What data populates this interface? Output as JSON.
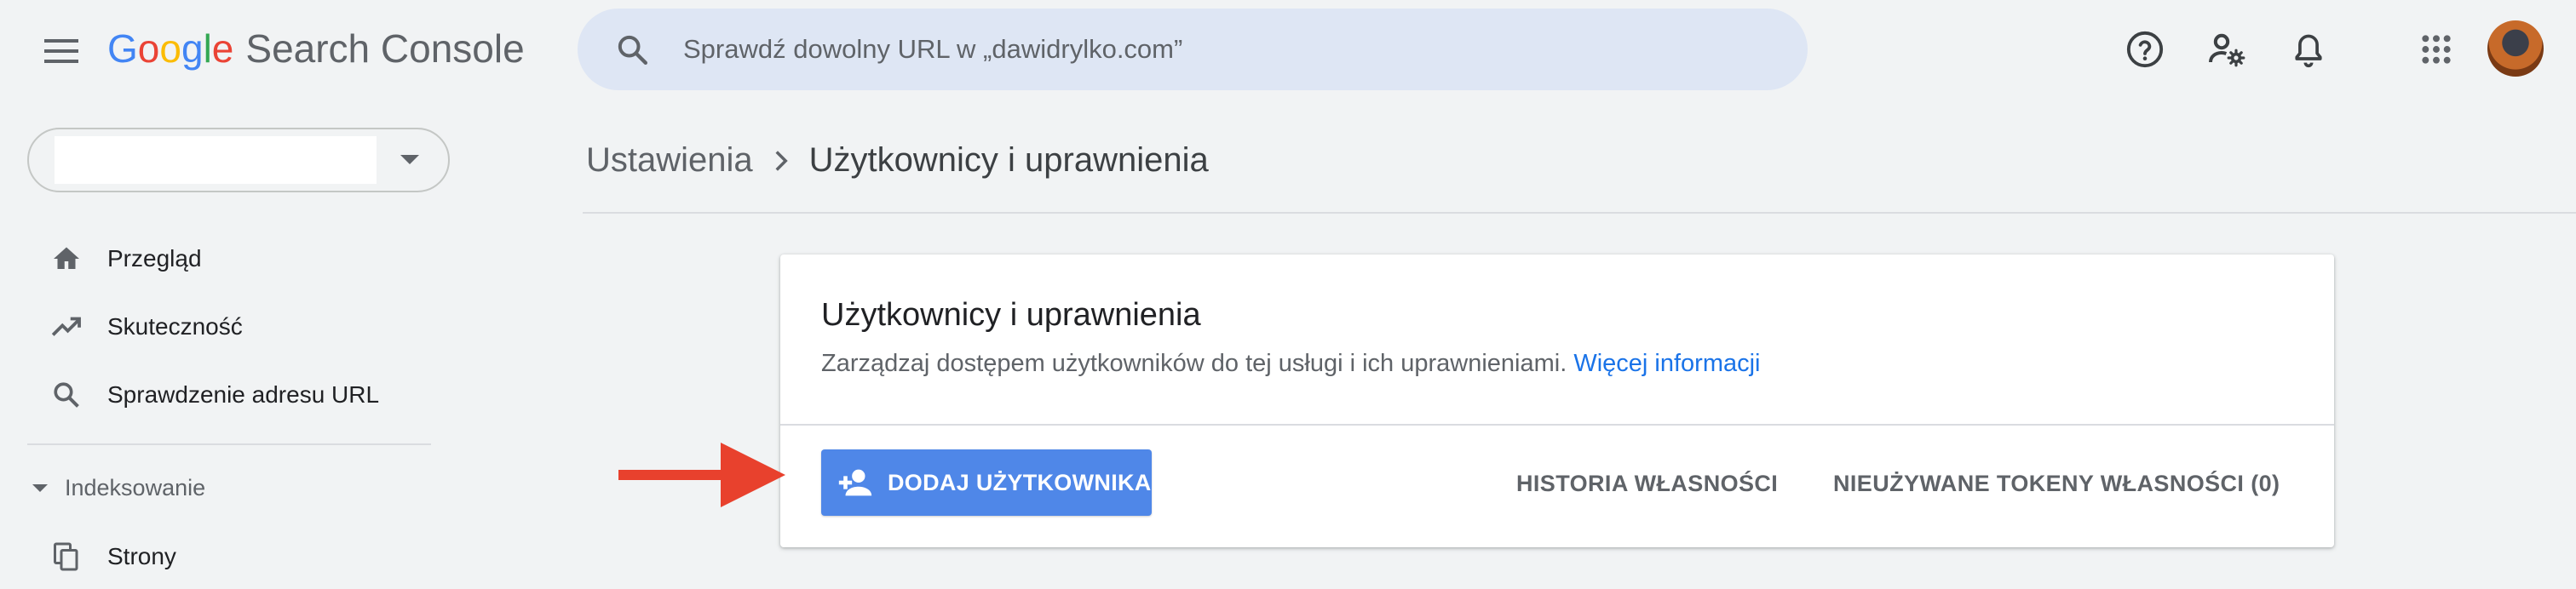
{
  "app": {
    "logo_letters": [
      "G",
      "o",
      "o",
      "g",
      "l",
      "e"
    ],
    "product_name": "Search Console"
  },
  "search": {
    "placeholder": "Sprawdź dowolny URL w „dawidrylko.com”"
  },
  "header_icons": [
    "help-icon",
    "manage-account-icon",
    "notifications-icon",
    "apps-grid-icon",
    "avatar"
  ],
  "property_selector": {
    "value": ""
  },
  "sidebar": {
    "items": [
      {
        "label": "Przegląd",
        "icon": "home-icon"
      },
      {
        "label": "Skuteczność",
        "icon": "trending-up-icon"
      },
      {
        "label": "Sprawdzenie adresu URL",
        "icon": "search-icon"
      }
    ],
    "section": {
      "label": "Indeksowanie",
      "items": [
        {
          "label": "Strony",
          "icon": "pages-icon"
        }
      ]
    }
  },
  "breadcrumb": {
    "parent": "Ustawienia",
    "current": "Użytkownicy i uprawnienia"
  },
  "card": {
    "title": "Użytkownicy i uprawnienia",
    "description": "Zarządzaj dostępem użytkowników do tej usługi i ich uprawnieniami.",
    "more_link": "Więcej informacji",
    "add_user_label": "DODAJ UŻYTKOWNIKA",
    "history_label": "HISTORIA WŁASNOŚCI",
    "tokens_label": "NIEUŻYWANE TOKENY WŁASNOŚCI (0)"
  },
  "colors": {
    "accent": "#4f87e8",
    "link": "#1a73e8",
    "annotation_arrow": "#e8412d"
  }
}
